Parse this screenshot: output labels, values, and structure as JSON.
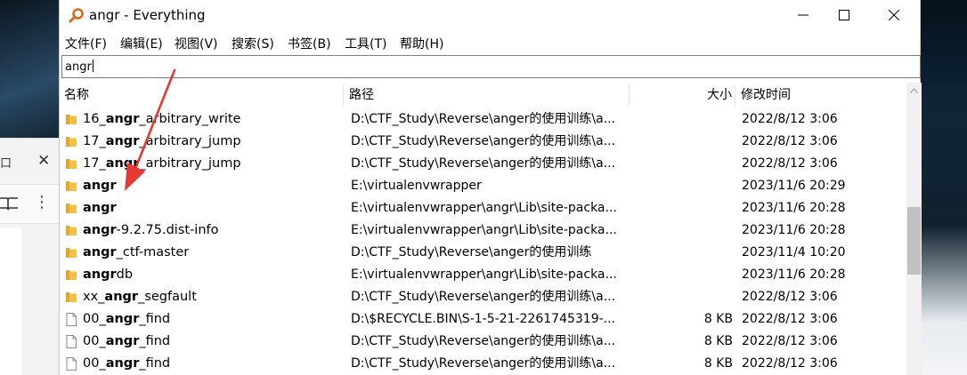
{
  "window": {
    "title": "angr - Everything"
  },
  "menu": [
    "文件(F)",
    "编辑(E)",
    "视图(V)",
    "搜索(S)",
    "书签(B)",
    "工具(T)",
    "帮助(H)"
  ],
  "search": {
    "value": "angr"
  },
  "columns": {
    "name": "名称",
    "path": "路径",
    "size": "大小",
    "modified": "修改时间"
  },
  "rows": [
    {
      "type": "folder",
      "pre": "16_",
      "match": "angr",
      "post": "_arbitrary_write",
      "path": "D:\\CTF_Study\\Reverse\\anger的使用训练\\a...",
      "size": "",
      "modified": "2022/8/12 3:06"
    },
    {
      "type": "folder",
      "pre": "17_",
      "match": "angr",
      "post": "_arbitrary_jump",
      "path": "D:\\CTF_Study\\Reverse\\anger的使用训练\\a...",
      "size": "",
      "modified": "2022/8/12 3:06"
    },
    {
      "type": "folder",
      "pre": "17_",
      "match": "angr",
      "post": "_arbitrary_jump",
      "path": "D:\\CTF_Study\\Reverse\\anger的使用训练\\a...",
      "size": "",
      "modified": "2022/8/12 3:06"
    },
    {
      "type": "folder",
      "pre": "",
      "match": "angr",
      "post": "",
      "path": "E:\\virtualenvwrapper",
      "size": "",
      "modified": "2023/11/6 20:29"
    },
    {
      "type": "folder",
      "pre": "",
      "match": "angr",
      "post": "",
      "path": "E:\\virtualenvwrapper\\angr\\Lib\\site-packa...",
      "size": "",
      "modified": "2023/11/6 20:28"
    },
    {
      "type": "folder",
      "pre": "",
      "match": "angr",
      "post": "-9.2.75.dist-info",
      "path": "E:\\virtualenvwrapper\\angr\\Lib\\site-packa...",
      "size": "",
      "modified": "2023/11/6 20:28"
    },
    {
      "type": "folder",
      "pre": "",
      "match": "angr",
      "post": "_ctf-master",
      "path": "D:\\CTF_Study\\Reverse\\anger的使用训练",
      "size": "",
      "modified": "2023/11/4 10:20"
    },
    {
      "type": "folder",
      "pre": "",
      "match": "angr",
      "post": "db",
      "path": "E:\\virtualenvwrapper\\angr\\Lib\\site-packa...",
      "size": "",
      "modified": "2023/11/6 20:28"
    },
    {
      "type": "folder",
      "pre": "xx_",
      "match": "angr",
      "post": "_segfault",
      "path": "D:\\CTF_Study\\Reverse\\anger的使用训练\\a...",
      "size": "",
      "modified": "2022/8/12 3:06"
    },
    {
      "type": "file",
      "pre": "00_",
      "match": "angr",
      "post": "_find",
      "path": "D:\\$RECYCLE.BIN\\S-1-5-21-2261745319-...",
      "size": "8 KB",
      "modified": "2022/8/12 3:06"
    },
    {
      "type": "file",
      "pre": "00_",
      "match": "angr",
      "post": "_find",
      "path": "D:\\CTF_Study\\Reverse\\anger的使用训练\\a...",
      "size": "8 KB",
      "modified": "2022/8/12 3:06"
    },
    {
      "type": "file",
      "pre": "00_",
      "match": "angr",
      "post": "_find",
      "path": "D:\\CTF_Study\\Reverse\\anger的使用训练\\a...",
      "size": "8 KB",
      "modified": "2022/8/12 3:06"
    }
  ],
  "background": {
    "fragment": "口"
  },
  "colors": {
    "folder": "#f2c14a",
    "arrow": "#e53935",
    "scroll_thumb": "#c1c1c1"
  }
}
